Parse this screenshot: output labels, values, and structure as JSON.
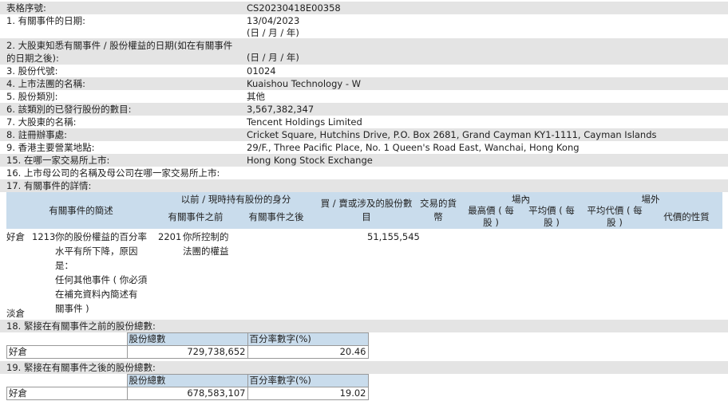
{
  "form": {
    "serial_label": "表格序號:",
    "serial_value": "CS20230418E00358",
    "item1_label": "1. 有關事件的日期:",
    "item1_value": "13/04/2023",
    "item1_format": "(日 / 月 / 年)",
    "item2_label_line1": "2. 大股東知悉有關事件 / 股份權益的日期(如在有關事件",
    "item2_label_line2": "的日期之後):",
    "item2_value": "(日 / 月 / 年)",
    "item3_label": "3. 股份代號:",
    "item3_value": "01024",
    "item4_label": "4. 上市法團的名稱:",
    "item4_value": "Kuaishou Technology - W",
    "item5_label": "5. 股份類別:",
    "item5_value": "其他",
    "item6_label": "6. 該類別的已發行股份的數目:",
    "item6_value": "3,567,382,347",
    "item7_label": "7. 大股東的名稱:",
    "item7_value": "Tencent Holdings Limited",
    "item8_label": "8. 註冊辦事處:",
    "item8_value": "Cricket Square, Hutchins Drive, P.O. Box 2681, Grand Cayman KY1-1111, Cayman Islands",
    "item9_label": "9. 香港主要營業地點:",
    "item9_value": "29/F., Three Pacific Place, No. 1 Queen's Road East, Wanchai, Hong Kong",
    "item15_label": "15. 在哪一家交易所上市:",
    "item15_value": "Hong Kong Stock Exchange",
    "item16_label": "16. 上市母公司的名稱及母公司在哪一家交易所上市:",
    "item17_label": "17. 有關事件的詳情:"
  },
  "details": {
    "h_event": "有關事件的簡述",
    "h_capacity_line1": "以前 / 現時持有股份的身分",
    "h_before": "有關事件之前",
    "h_after": "有關事件之後",
    "h_shares_line1": "買 / 賣或涉及的股份數",
    "h_shares_line2": "目",
    "h_currency_line1": "交易的貨",
    "h_currency_line2": "幣",
    "h_on_exchange": "場內",
    "h_high_line1": "最高價 ( 每",
    "h_high_line2": "股 )",
    "h_avg_line1": "平均價 ( 每",
    "h_avg_line2": "股 )",
    "h_off_exchange": "場外",
    "h_consideration_line1": "平均代價 ( 每",
    "h_consideration_line2": "股 )",
    "h_nature": "代價的性質",
    "row": {
      "position": "好倉",
      "event_code": "1213",
      "event_desc": [
        "你的股份權益的百分率",
        "水平有所下降，原因",
        "是：",
        "任何其他事件 ( 你必須",
        "在補充資料內簡述有",
        "關事件 )"
      ],
      "capacity_code": "2201",
      "capacity_desc": [
        "你所控制的",
        "法團的權益"
      ],
      "shares": "51,155,545"
    },
    "short_label": "淡倉"
  },
  "item18": {
    "title": "18. 緊接在有關事件之前的股份總數:",
    "col_shares": "股份總數",
    "col_pct": "百分率數字(%)",
    "row_label": "好倉",
    "shares": "729,738,652",
    "pct": "20.46"
  },
  "item19": {
    "title": "19. 緊接在有關事件之後的股份總數:",
    "col_shares": "股份總數",
    "col_pct": "百分率數字(%)",
    "row_label": "好倉",
    "shares": "678,583,107",
    "pct": "19.02"
  }
}
